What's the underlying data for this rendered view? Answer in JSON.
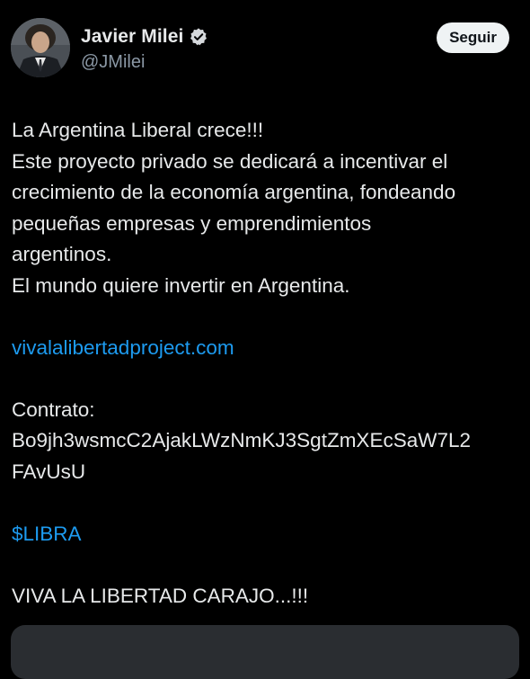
{
  "author": {
    "display_name": "Javier Milei",
    "handle": "@JMilei",
    "verified_icon": "verified-badge-icon"
  },
  "actions": {
    "follow_label": "Seguir"
  },
  "tweet": {
    "line1": "La Argentina Liberal crece!!!",
    "line2": "Este proyecto privado se dedicará a incentivar el",
    "line3": "crecimiento de la economía argentina, fondeando",
    "line4": "pequeñas empresas y emprendimientos",
    "line5": "argentinos.",
    "line6": "El mundo quiere invertir en Argentina.",
    "link_url": "vivalalibertadproject.com",
    "contract_label": "Contrato:",
    "contract_line1": "Bo9jh3wsmcC2AjakLWzNmKJ3SgtZmXEcSaW7L2",
    "contract_line2": "FAvUsU",
    "cashtag": "$LIBRA",
    "closing": "VIVA LA LIBERTAD CARAJO...!!!"
  },
  "colors": {
    "background": "#000000",
    "text": "#e7e9ea",
    "secondary_text": "#8b98a5",
    "link": "#1d9bf0",
    "verified": "#d6d9dc"
  }
}
